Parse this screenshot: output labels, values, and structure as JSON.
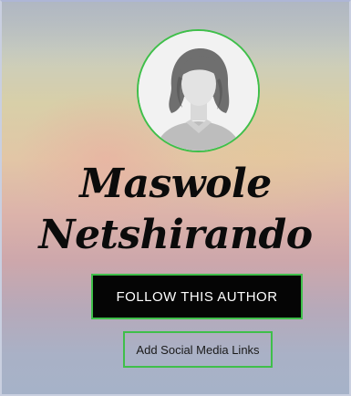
{
  "profile": {
    "avatar_icon": "default-female-avatar-icon",
    "name_line_1": "Maswole",
    "name_line_2": "Netshirando"
  },
  "actions": {
    "follow_label": "FOLLOW THIS AUTHOR",
    "social_label": "Add Social Media Links"
  },
  "colors": {
    "accent": "#3fbf4a",
    "follow_bg": "#050505"
  }
}
